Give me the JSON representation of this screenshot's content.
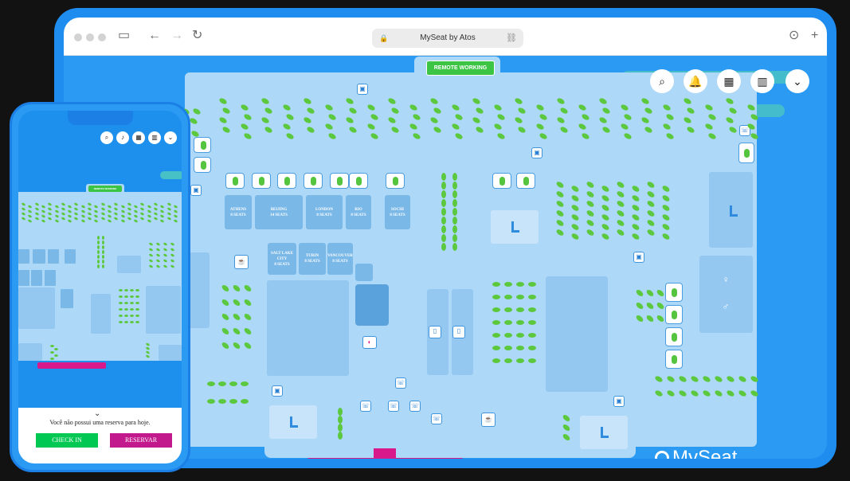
{
  "browser": {
    "url_title": "MySeat by Atos"
  },
  "map": {
    "remote_working_label": "REMOTE WORKING",
    "rooms": [
      {
        "name": "ATHENS",
        "seats": "8 SEATS"
      },
      {
        "name": "BEIJING",
        "seats": "14 SEATS"
      },
      {
        "name": "LONDON",
        "seats": "8 SEATS"
      },
      {
        "name": "RIO",
        "seats": "8 SEATS"
      },
      {
        "name": "SOCHI",
        "seats": "8 SEATS"
      },
      {
        "name": "SALT LAKE CITY",
        "seats": "8 SEATS"
      },
      {
        "name": "TURIN",
        "seats": "8 SEATS"
      },
      {
        "name": "VANCOUVER",
        "seats": "8 SEATS"
      }
    ]
  },
  "brand": {
    "logo_text": "MySeat"
  },
  "phone": {
    "remote_working_label": "REMOTE WORKING",
    "no_reservation": "Você não possui uma reserva para hoje.",
    "checkin_label": "CHECK IN",
    "reserve_label": "RESERVAR"
  },
  "colors": {
    "accent_blue": "#2a9af3",
    "seat_green": "#5cc83e",
    "checkin_green": "#00c853",
    "reserve_magenta": "#c2198c"
  },
  "icons": {
    "toolbar": [
      "search-icon",
      "bell-icon",
      "calendar-icon",
      "building-icon",
      "chevron-down-icon"
    ]
  }
}
